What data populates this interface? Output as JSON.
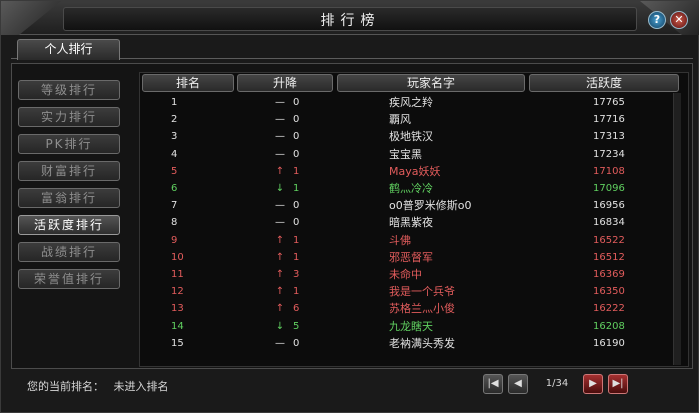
{
  "window": {
    "title": "排行榜"
  },
  "title_buttons": {
    "help": "?",
    "close": "✕"
  },
  "tabs": [
    {
      "label": "个人排行"
    }
  ],
  "sidebar": {
    "items": [
      {
        "label": "等级排行",
        "active": false
      },
      {
        "label": "实力排行",
        "active": false
      },
      {
        "label": "PK排行",
        "active": false
      },
      {
        "label": "财富排行",
        "active": false
      },
      {
        "label": "富翁排行",
        "active": false
      },
      {
        "label": "活跃度排行",
        "active": true
      },
      {
        "label": "战绩排行",
        "active": false
      },
      {
        "label": "荣誉值排行",
        "active": false
      }
    ]
  },
  "table": {
    "headers": {
      "rank": "排名",
      "change": "升降",
      "name": "玩家名字",
      "score": "活跃度"
    },
    "rows": [
      {
        "rank": "1",
        "arrow": "—",
        "trend": "flat",
        "change": "0",
        "name": "疾风之羚",
        "score": "17765",
        "color": "white"
      },
      {
        "rank": "2",
        "arrow": "—",
        "trend": "flat",
        "change": "0",
        "name": "覇风",
        "score": "17716",
        "color": "white"
      },
      {
        "rank": "3",
        "arrow": "—",
        "trend": "flat",
        "change": "0",
        "name": "极地铁汉",
        "score": "17313",
        "color": "white"
      },
      {
        "rank": "4",
        "arrow": "—",
        "trend": "flat",
        "change": "0",
        "name": "宝宝黑",
        "score": "17234",
        "color": "white"
      },
      {
        "rank": "5",
        "arrow": "↑",
        "trend": "up",
        "change": "1",
        "name": "Maya妖妖",
        "score": "17108",
        "color": "red"
      },
      {
        "rank": "6",
        "arrow": "↓",
        "trend": "down",
        "change": "1",
        "name": "鹤灬冷冷",
        "score": "17096",
        "color": "green"
      },
      {
        "rank": "7",
        "arrow": "—",
        "trend": "flat",
        "change": "0",
        "name": "o0普罗米修斯o0",
        "score": "16956",
        "color": "white"
      },
      {
        "rank": "8",
        "arrow": "—",
        "trend": "flat",
        "change": "0",
        "name": "暗黑紫夜",
        "score": "16834",
        "color": "white"
      },
      {
        "rank": "9",
        "arrow": "↑",
        "trend": "up",
        "change": "1",
        "name": "斗佛",
        "score": "16522",
        "color": "red"
      },
      {
        "rank": "10",
        "arrow": "↑",
        "trend": "up",
        "change": "1",
        "name": "邪恶督军",
        "score": "16512",
        "color": "red"
      },
      {
        "rank": "11",
        "arrow": "↑",
        "trend": "up",
        "change": "3",
        "name": "未命中",
        "score": "16369",
        "color": "red"
      },
      {
        "rank": "12",
        "arrow": "↑",
        "trend": "up",
        "change": "1",
        "name": "我是一个兵爷",
        "score": "16350",
        "color": "red"
      },
      {
        "rank": "13",
        "arrow": "↑",
        "trend": "up",
        "change": "6",
        "name": "苏格兰灬小俊",
        "score": "16222",
        "color": "red"
      },
      {
        "rank": "14",
        "arrow": "↓",
        "trend": "down",
        "change": "5",
        "name": "九龙瞎天",
        "score": "16208",
        "color": "green"
      },
      {
        "rank": "15",
        "arrow": "—",
        "trend": "flat",
        "change": "0",
        "name": "老衲满头秀发",
        "score": "16190",
        "color": "white"
      }
    ]
  },
  "footer": {
    "current_rank_label": "您的当前排名：",
    "current_rank_value": "未进入排名",
    "page_indicator": "1/34"
  },
  "pager": {
    "first_icon": "first-page-icon",
    "prev_icon": "prev-page-icon",
    "next_icon": "next-page-icon",
    "last_icon": "last-page-icon"
  }
}
